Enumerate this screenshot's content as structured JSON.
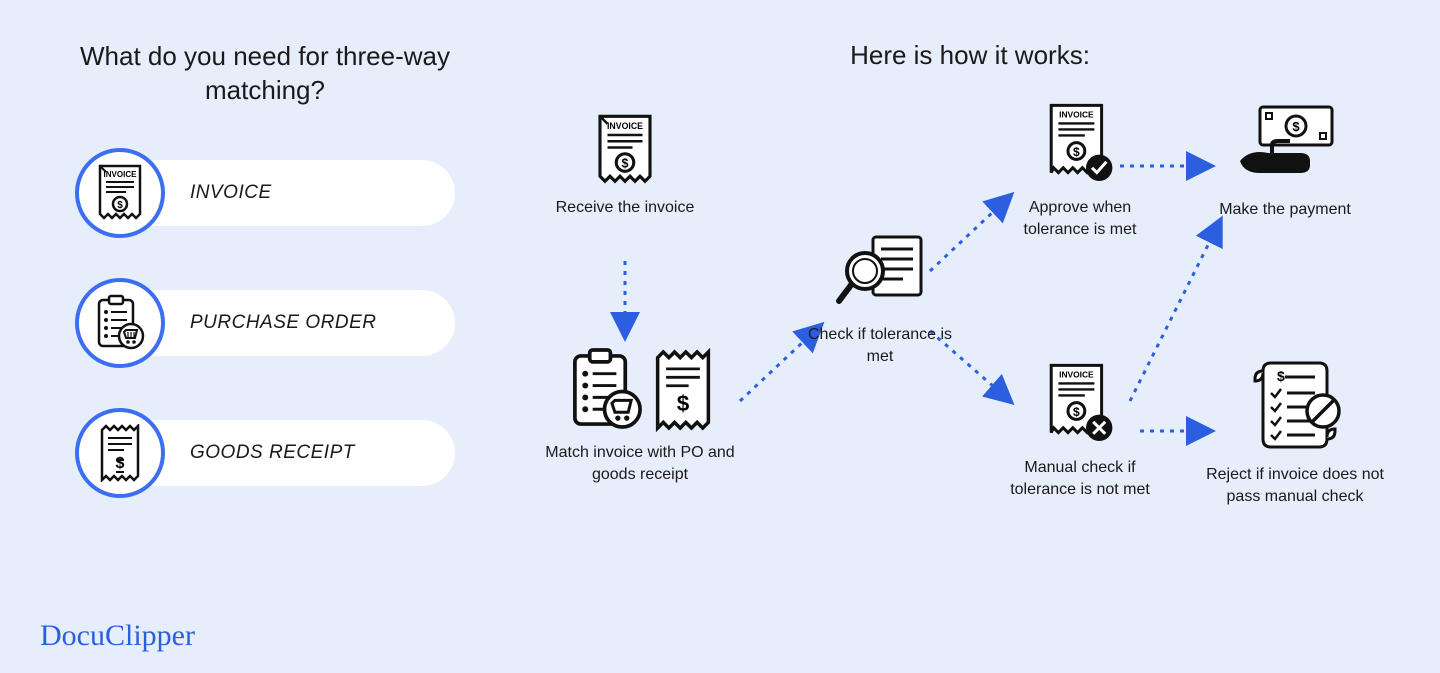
{
  "left": {
    "title": "What do you need for three-way matching?",
    "items": [
      {
        "label": "INVOICE"
      },
      {
        "label": "PURCHASE ORDER"
      },
      {
        "label": "GOODS RECEIPT"
      }
    ]
  },
  "right": {
    "title": "Here is how it works:",
    "steps": {
      "receive": "Receive the invoice",
      "match": "Match invoice with PO and goods receipt",
      "check": "Check if tolerance is met",
      "approve": "Approve when tolerance is met",
      "manual": "Manual check if tolerance is not met",
      "pay": "Make the payment",
      "reject": "Reject if invoice does not pass manual check"
    }
  },
  "brand": "DocuClipper"
}
